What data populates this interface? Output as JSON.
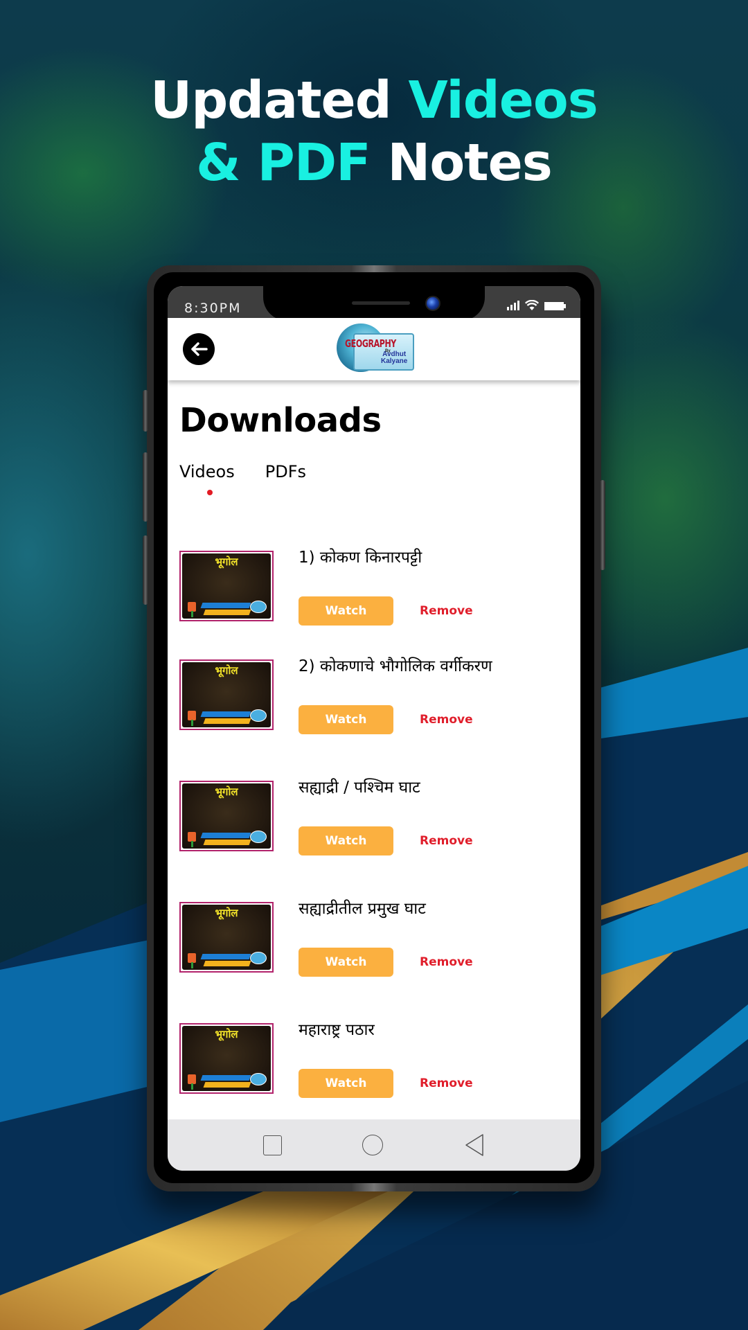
{
  "promo": {
    "line1_white": "Updated ",
    "line1_accent": "Videos",
    "line2_accent": "& PDF",
    "line2_white": " Notes",
    "accent_color": "#19f0e1"
  },
  "status_bar": {
    "time": "8:30PM",
    "icons": [
      "signal-icon",
      "wifi-icon",
      "battery-icon"
    ]
  },
  "app_bar": {
    "back_icon": "arrow-left-icon",
    "logo": {
      "title": "GEOGRAPHY",
      "by": "By",
      "name_line1": "Avdhut",
      "name_line2": "Kalyane"
    }
  },
  "page": {
    "title": "Downloads",
    "tabs": [
      {
        "label": "Videos",
        "active": true
      },
      {
        "label": "PDFs",
        "active": false
      }
    ],
    "active_indicator_color": "#e21b24"
  },
  "downloads": [
    {
      "thumb_label": "भूगोल",
      "title": "1) कोकण किनारपट्टी",
      "watch_label": "Watch",
      "remove_label": "Remove"
    },
    {
      "thumb_label": "भूगोल",
      "title": "2) कोकणाचे भौगोलिक वर्गीकरण",
      "watch_label": "Watch",
      "remove_label": "Remove"
    },
    {
      "thumb_label": "भूगोल",
      "title": "सह्याद्री / पश्चिम घाट",
      "watch_label": "Watch",
      "remove_label": "Remove"
    },
    {
      "thumb_label": "भूगोल",
      "title": "सह्याद्रीतील प्रमुख घाट",
      "watch_label": "Watch",
      "remove_label": "Remove"
    },
    {
      "thumb_label": "भूगोल",
      "title": "महाराष्ट्र पठार",
      "watch_label": "Watch",
      "remove_label": "Remove"
    }
  ],
  "colors": {
    "watch_button": "#fbb040",
    "remove_text": "#e01e2b",
    "thumb_border": "#b2236b"
  },
  "nav_bar": {
    "buttons": [
      "recent-apps-icon",
      "home-icon",
      "back-triangle-icon"
    ]
  }
}
